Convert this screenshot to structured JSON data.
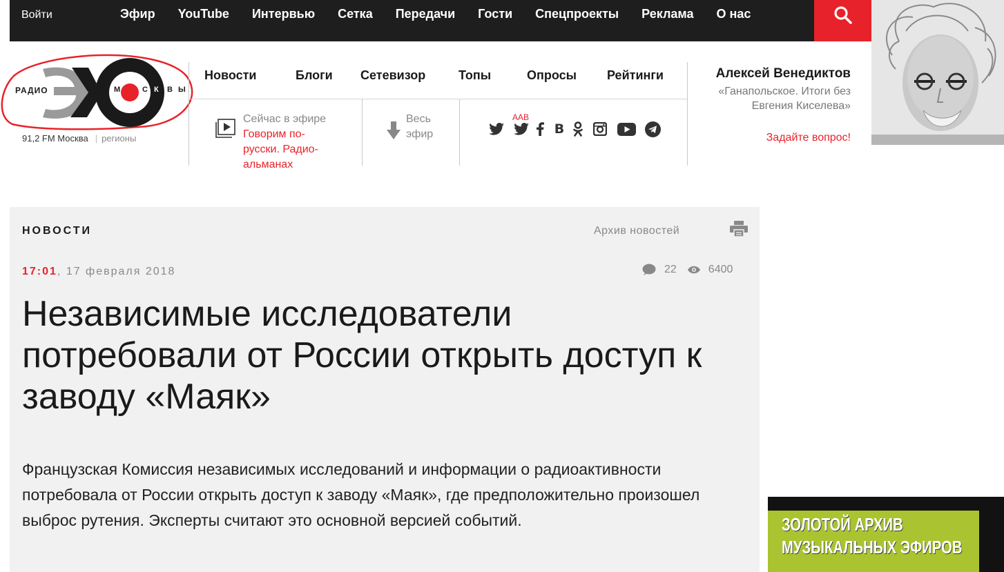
{
  "topbar": {
    "login": "Войти",
    "nav": [
      "Эфир",
      "YouTube",
      "Интервью",
      "Сетка",
      "Передачи",
      "Гости",
      "Спецпроекты",
      "Реклама",
      "О нас"
    ],
    "search_icon": "search-icon"
  },
  "logo": {
    "radio": "РАДИО",
    "moskvy": [
      "М",
      "С",
      "К",
      "В",
      "Ы"
    ],
    "frequency": "91,2 FM Москва",
    "regions": "регионы"
  },
  "mainnav": [
    "Новости",
    "Блоги",
    "Сетевизор",
    "Топы",
    "Опросы",
    "Рейтинги"
  ],
  "onair": {
    "label": "Сейчас в эфире",
    "show": "Говорим по-русски. Радио-альманах"
  },
  "allair": {
    "label": "Весь эфир"
  },
  "social": {
    "aab": "ААВ",
    "icons": [
      "twitter-icon",
      "twitter-aab-icon",
      "facebook-icon",
      "vk-icon",
      "odnoklassniki-icon",
      "instagram-icon",
      "youtube-icon",
      "telegram-icon"
    ]
  },
  "host": {
    "name": "Алексей Венедиктов",
    "show": "«Ганапольское. Итоги без Евгения Киселева»",
    "ask": "Задайте вопрос!"
  },
  "article": {
    "section": "НОВОСТИ",
    "archive": "Архив новостей",
    "time": "17:01",
    "date": "17 февраля 2018",
    "comments": "22",
    "views": "6400",
    "headline": "Независимые исследователи потребовали от России открыть доступ к заводу «Маяк»",
    "lead": "Французская Комиссия независимых исследований и информации о радиоактивности потребовала от России открыть доступ к заводу «Маяк», где предположительно произошел выброс рутения. Эксперты считают это основной версией событий."
  },
  "banner": {
    "line1": "Золотой архив",
    "line2": "музыкальных эфиров"
  },
  "colors": {
    "accent": "#e8222a",
    "topbar": "#1e1e1e",
    "article_bg": "#f1f1f1",
    "banner_green": "#a9c430"
  }
}
